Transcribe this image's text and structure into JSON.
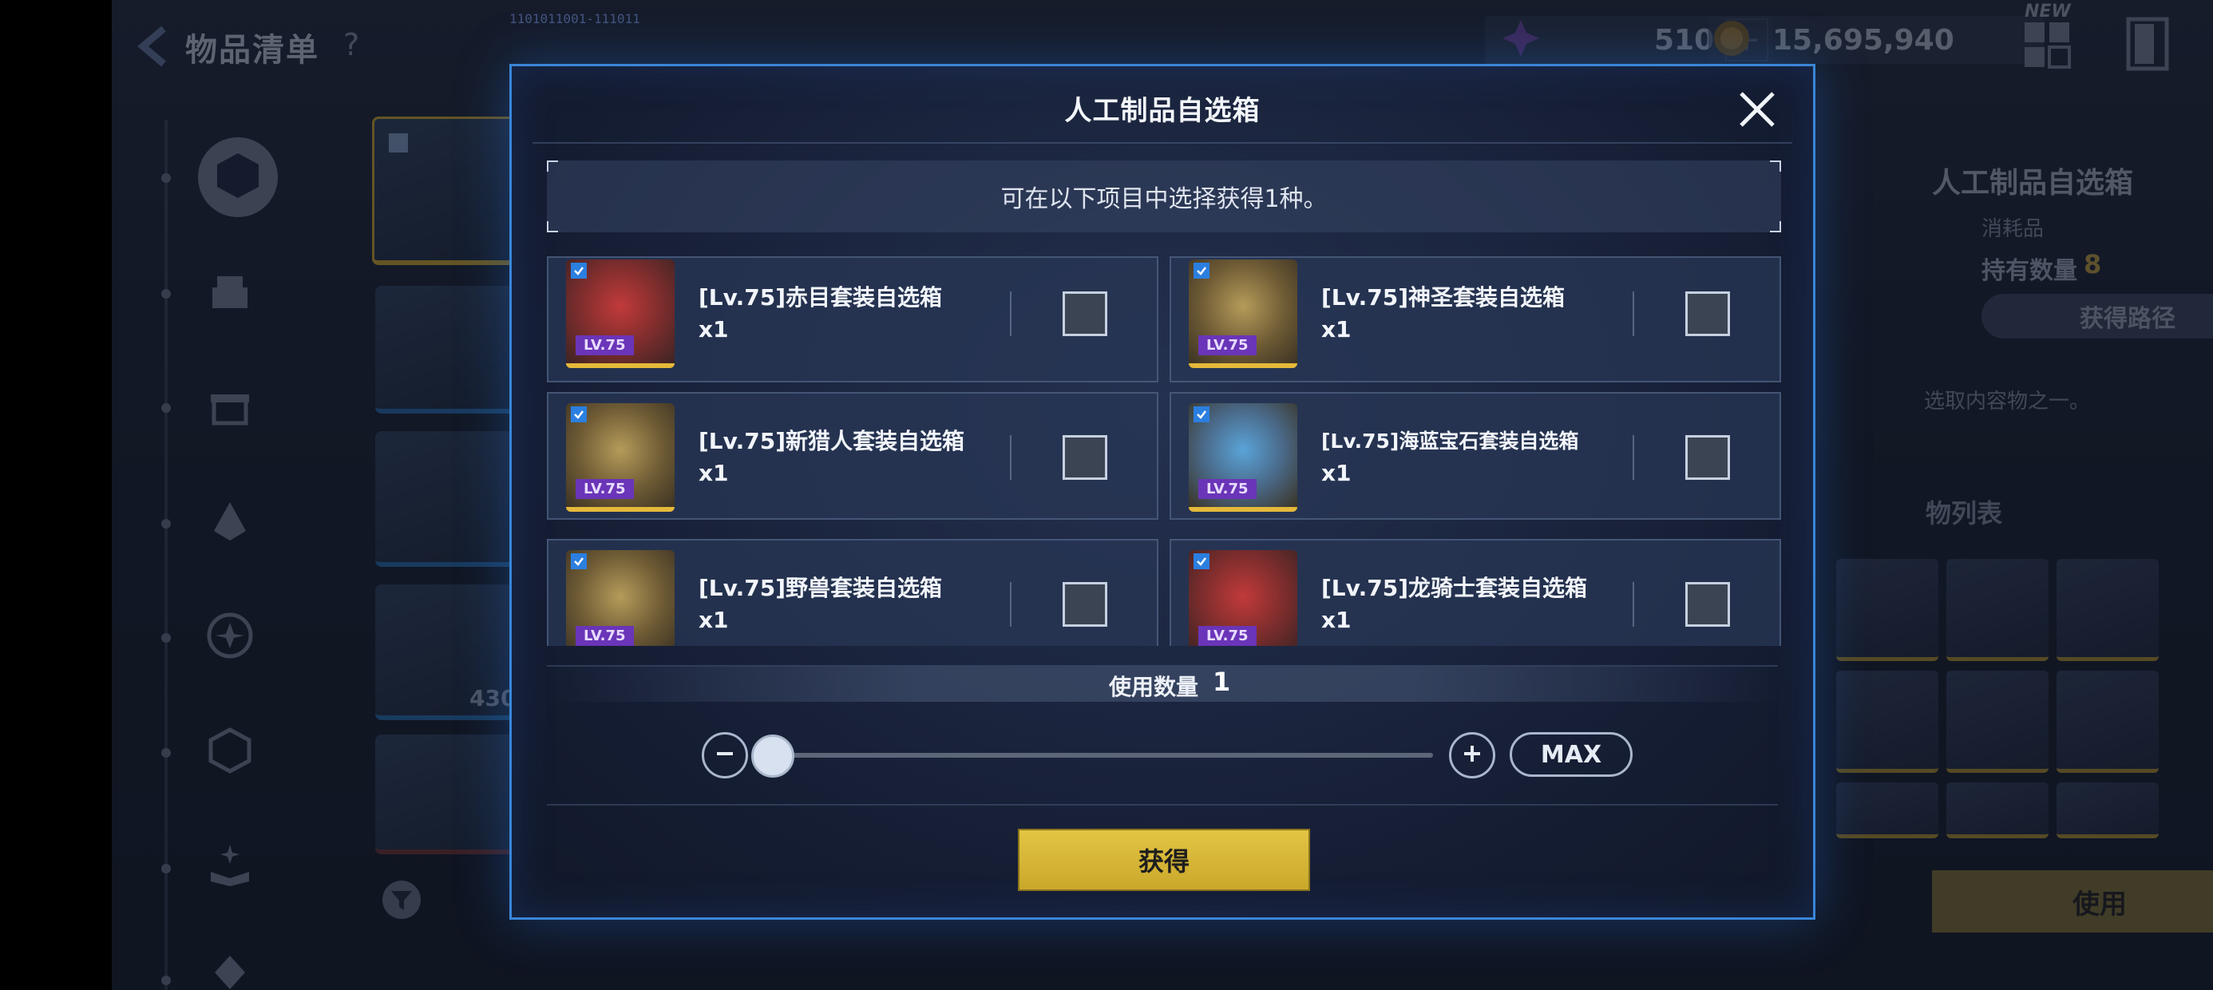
{
  "background": {
    "title": "物品清单",
    "help": "?",
    "debug_id": "1101011001-111011",
    "currency_gems": "510",
    "currency_gold": "15,695,940",
    "new_badge": "NEW",
    "side_item_count": "430",
    "panel": {
      "item_name": "人工制品自选箱",
      "item_type": "消耗品",
      "hold_label": "持有数量",
      "hold_value": "8",
      "route_button": "获得路径",
      "desc_fragment": "选取内容物之一。",
      "list_title_fragment": "物列表",
      "use_button": "使用"
    }
  },
  "modal": {
    "title": "人工制品自选箱",
    "hint": "可在以下项目中选择获得1种。",
    "options": [
      {
        "name": "[Lv.75]赤目套装自选箱",
        "qty": "x1",
        "badge": "LV.75",
        "checked": false
      },
      {
        "name": "[Lv.75]神圣套装自选箱",
        "qty": "x1",
        "badge": "LV.75",
        "checked": false
      },
      {
        "name": "[Lv.75]新猎人套装自选箱",
        "qty": "x1",
        "badge": "LV.75",
        "checked": false
      },
      {
        "name": "[Lv.75]海蓝宝石套装自选箱",
        "qty": "x1",
        "badge": "LV.75",
        "checked": false
      },
      {
        "name": "[Lv.75]野兽套装自选箱",
        "qty": "x1",
        "badge": "LV.75",
        "checked": false
      },
      {
        "name": "[Lv.75]龙骑士套装自选箱",
        "qty": "x1",
        "badge": "LV.75",
        "checked": false
      }
    ],
    "quantity_label": "使用数量",
    "quantity_value": "1",
    "slider_fraction": 0,
    "max_button": "MAX",
    "obtain_button": "获得"
  },
  "colors": {
    "modal_border": "#3a86d8",
    "obtain_button": "#d9b83a",
    "level_badge": "#6a35b8",
    "thumb_rarity_border": "#e5b93a"
  },
  "icons": [
    "back-arrow-icon",
    "gem-icon",
    "gold-coin-icon",
    "plus-icon",
    "grid-menu-icon",
    "exit-door-icon",
    "close-icon",
    "minus-icon",
    "check-icon",
    "filter-icon"
  ]
}
